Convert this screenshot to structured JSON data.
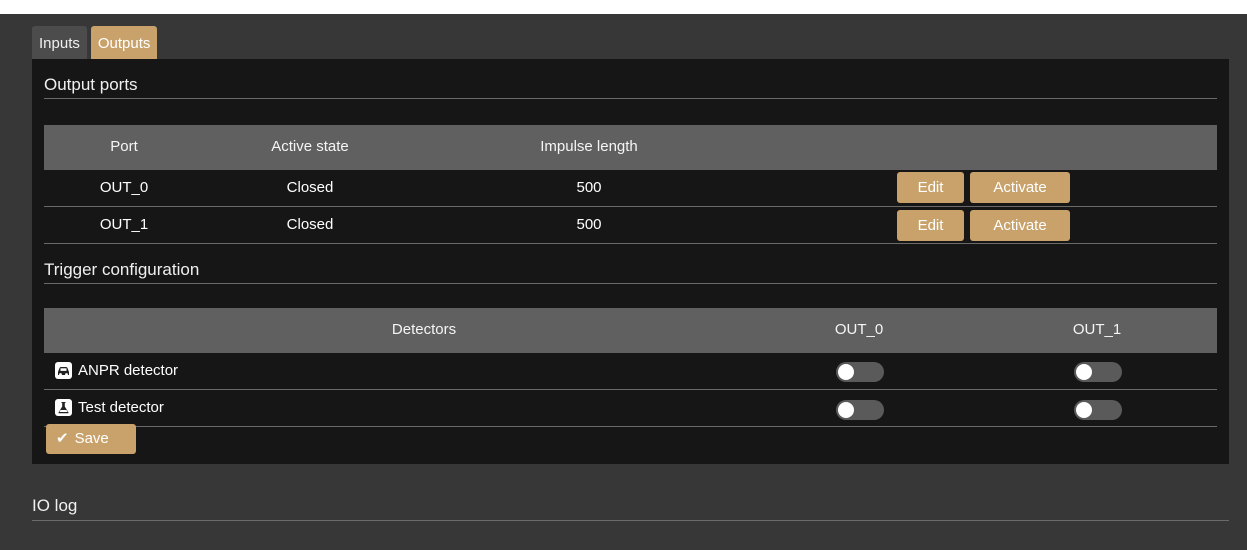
{
  "tabs": [
    {
      "label": "Inputs",
      "active": false
    },
    {
      "label": "Outputs",
      "active": true
    }
  ],
  "output_ports": {
    "title": "Output ports",
    "headers": {
      "port": "Port",
      "active_state": "Active state",
      "impulse_length": "Impulse length"
    },
    "rows": [
      {
        "port": "OUT_0",
        "active_state": "Closed",
        "impulse_length": "500",
        "edit_label": "Edit",
        "activate_label": "Activate"
      },
      {
        "port": "OUT_1",
        "active_state": "Closed",
        "impulse_length": "500",
        "edit_label": "Edit",
        "activate_label": "Activate"
      }
    ]
  },
  "trigger_configuration": {
    "title": "Trigger configuration",
    "headers": {
      "detectors": "Detectors",
      "out_0": "OUT_0",
      "out_1": "OUT_1"
    },
    "rows": [
      {
        "detector": "ANPR detector",
        "icon": "car-icon",
        "out_0": false,
        "out_1": false
      },
      {
        "detector": "Test detector",
        "icon": "flask-icon",
        "out_0": false,
        "out_1": false
      }
    ],
    "save_label": "Save"
  },
  "io_log": {
    "title": "IO log"
  },
  "colors": {
    "accent": "#c8a26a",
    "panel_bg": "#161616",
    "app_bg": "#373737",
    "header_bg": "#606060"
  }
}
